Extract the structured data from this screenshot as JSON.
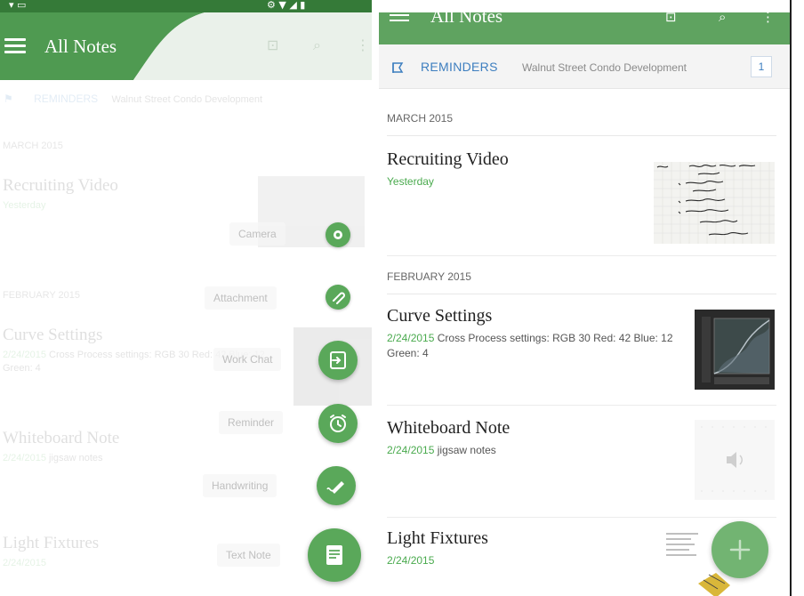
{
  "left": {
    "title": "All Notes",
    "reminders_label": "REMINDERS",
    "reminders_sub": "Walnut Street Condo Development",
    "sections": [
      "MARCH 2015",
      "FEBRUARY 2015"
    ],
    "notes": [
      {
        "title": "Recruiting Video",
        "date": "Yesterday",
        "body": ""
      },
      {
        "title": "Curve Settings",
        "date": "2/24/2015",
        "body": "Cross Process settings: RGB 30 Red: 42 Blue: 12 Green: 4"
      },
      {
        "title": "Whiteboard Note",
        "date": "2/24/2015",
        "body": "jigsaw notes"
      },
      {
        "title": "Light Fixtures",
        "date": "2/24/2015",
        "body": ""
      }
    ],
    "fab_menu": {
      "camera": "Camera",
      "attachment": "Attachment",
      "work_chat": "Work Chat",
      "reminder": "Reminder",
      "handwriting": "Handwriting",
      "text_note": "Text Note"
    }
  },
  "right": {
    "title": "All Notes",
    "reminders_label": "REMINDERS",
    "reminders_sub": "Walnut Street Condo Development",
    "reminders_count": "1",
    "sections": [
      "MARCH 2015",
      "FEBRUARY 2015"
    ],
    "notes": [
      {
        "title": "Recruiting Video",
        "date": "Yesterday",
        "body": ""
      },
      {
        "title": "Curve Settings",
        "date": "2/24/2015",
        "body": "Cross Process settings: RGB 30 Red: 42 Blue: 12 Green: 4"
      },
      {
        "title": "Whiteboard Note",
        "date": "2/24/2015",
        "body": "jigsaw notes"
      },
      {
        "title": "Light Fixtures",
        "date": "2/24/2015",
        "body": ""
      }
    ]
  },
  "colors": {
    "brand_green": "#5fa360",
    "date_green": "#4aaa4e",
    "reminder_blue": "#3d7ebf"
  },
  "icons": {
    "menu": "hamburger-icon",
    "work_chat": "work-chat-icon",
    "search": "search-icon",
    "overflow": "more-vert-icon",
    "bell": "reminder-bell-icon",
    "camera": "camera-icon",
    "attachment": "paperclip-icon",
    "alarm": "alarm-clock-icon",
    "handwriting": "pen-icon",
    "text_note": "note-icon",
    "add": "plus-icon"
  }
}
